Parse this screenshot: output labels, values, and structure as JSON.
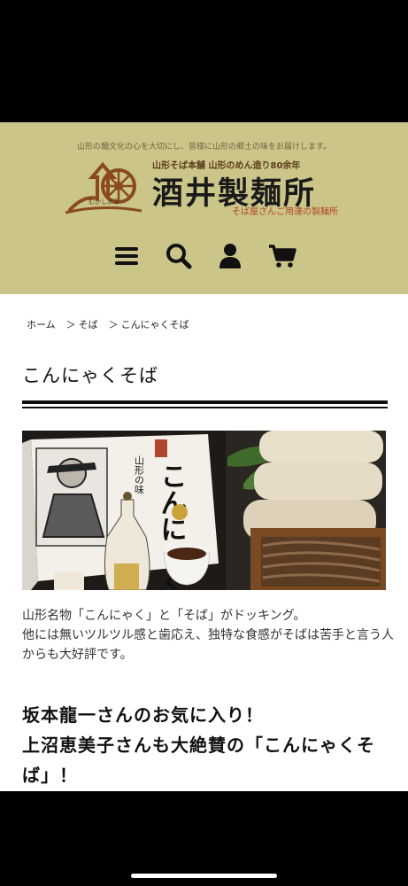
{
  "header": {
    "tagline": "山形の麺文化の心を大切にし、皆様に山形の郷土の味をお届けします。",
    "logo_sub": "むかし水車",
    "logo_top": "山形そば本舗 山形のめん造り80余年",
    "logo_main": "酒井製麺所",
    "logo_tail": "そば屋さんご用達の製麺所"
  },
  "nav": {
    "icons": [
      "menu-icon",
      "search-icon",
      "user-icon",
      "cart-icon"
    ]
  },
  "breadcrumb": {
    "home": "ホーム",
    "sep1": "＞",
    "cat": "そば",
    "sep2": "＞",
    "current": "こんにゃくそば"
  },
  "page": {
    "title": "こんにゃくそば",
    "box_text": "こんにゃくそば",
    "box_small": "山形の味",
    "desc_line1": "山形名物「こんにゃく」と「そば」がドッキング。",
    "desc_line2": "他には無いツルツル感と歯応え、独特な食感がそばは苦手と言う人からも大好評です。",
    "headline_line1": "坂本龍一さんのお気に入り！",
    "headline_line2": "上沼恵美子さんも大絶賛の「こんにゃくそば」！"
  },
  "colors": {
    "header_bg": "#cbc589",
    "accent_red": "#b0452d",
    "text_dark": "#111111"
  }
}
